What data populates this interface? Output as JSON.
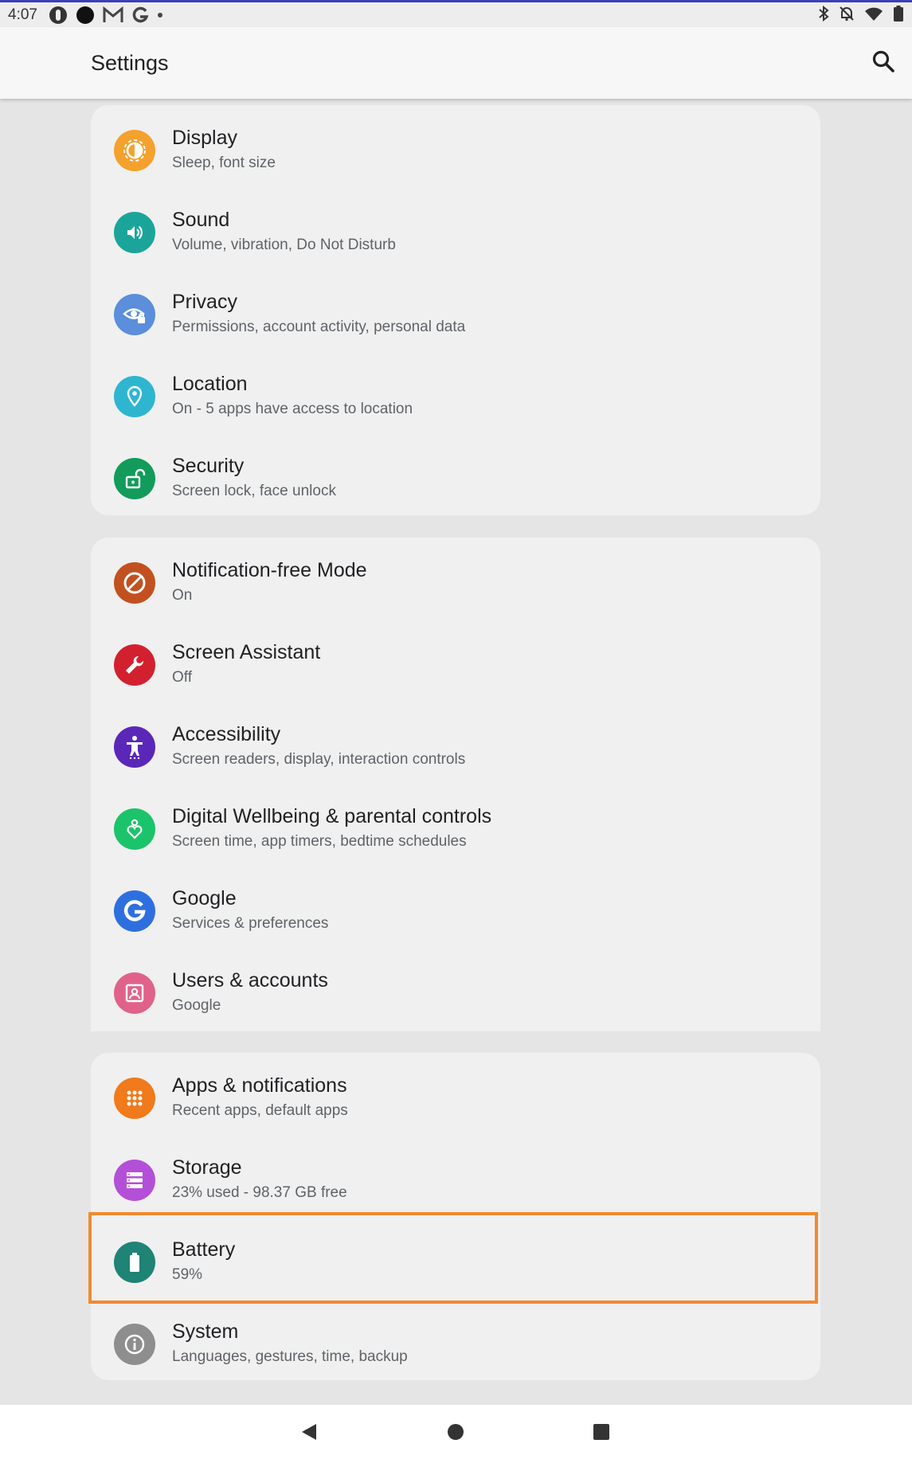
{
  "status_bar": {
    "time": "4:07"
  },
  "app_bar": {
    "title": "Settings"
  },
  "groups": [
    {
      "items": [
        {
          "title": "Display",
          "subtitle": "Sleep, font size",
          "icon": "display-icon",
          "color": "#F4A12E"
        },
        {
          "title": "Sound",
          "subtitle": "Volume, vibration, Do Not Disturb",
          "icon": "sound-icon",
          "color": "#1BA59A"
        },
        {
          "title": "Privacy",
          "subtitle": "Permissions, account activity, personal data",
          "icon": "privacy-icon",
          "color": "#5B8EDB"
        },
        {
          "title": "Location",
          "subtitle": "On - 5 apps have access to location",
          "icon": "location-icon",
          "color": "#2EB6D0"
        },
        {
          "title": "Security",
          "subtitle": "Screen lock, face unlock",
          "icon": "security-icon",
          "color": "#129B5A"
        }
      ]
    },
    {
      "items": [
        {
          "title": "Notification-free Mode",
          "subtitle": "On",
          "icon": "do-not-disturb-icon",
          "color": "#C2511F"
        },
        {
          "title": "Screen Assistant",
          "subtitle": "Off",
          "icon": "wrench-icon",
          "color": "#D3202F"
        },
        {
          "title": "Accessibility",
          "subtitle": "Screen readers, display, interaction controls",
          "icon": "accessibility-icon",
          "color": "#5B27B8"
        },
        {
          "title": "Digital Wellbeing & parental controls",
          "subtitle": "Screen time, app timers, bedtime schedules",
          "icon": "wellbeing-icon",
          "color": "#1BC46A"
        },
        {
          "title": "Google",
          "subtitle": "Services & preferences",
          "icon": "google-icon",
          "color": "#2E6FE0"
        },
        {
          "title": "Users & accounts",
          "subtitle": "Google",
          "icon": "users-icon",
          "color": "#E0628A"
        }
      ]
    },
    {
      "items": [
        {
          "title": "Apps & notifications",
          "subtitle": "Recent apps, default apps",
          "icon": "apps-icon",
          "color": "#F07A1C"
        },
        {
          "title": "Storage",
          "subtitle": "23% used - 98.37 GB free",
          "icon": "storage-icon",
          "color": "#B44FD8"
        },
        {
          "title": "Battery",
          "subtitle": "59%",
          "icon": "battery-icon",
          "color": "#1F8376"
        },
        {
          "title": "System",
          "subtitle": "Languages, gestures, time, backup",
          "icon": "info-icon",
          "color": "#8E8E8E"
        }
      ]
    }
  ],
  "highlight_color": "#F08A2F"
}
